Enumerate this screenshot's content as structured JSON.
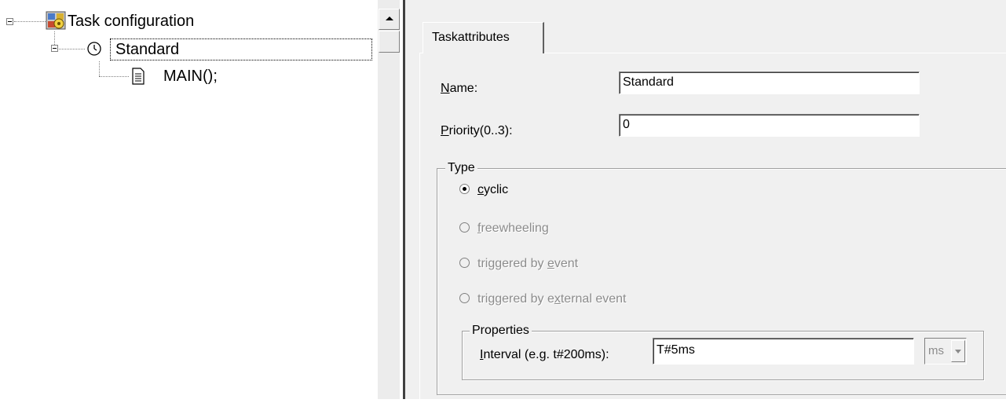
{
  "tree": {
    "root_label": "Task configuration",
    "task_label": "Standard",
    "program_label": "MAIN();"
  },
  "tab": {
    "label": "Taskattributes"
  },
  "fields": {
    "name_label_u": "N",
    "name_label_rest": "ame:",
    "name_value": "Standard",
    "priority_label_u": "P",
    "priority_label_rest": "riority(0..3):",
    "priority_value": "0"
  },
  "type_group": {
    "title": "Type",
    "options": [
      {
        "pre": "",
        "u": "c",
        "post": "yclic",
        "checked": true,
        "enabled": true
      },
      {
        "pre": "",
        "u": "f",
        "post": "reewheeling",
        "checked": false,
        "enabled": false
      },
      {
        "pre": "triggered by ",
        "u": "e",
        "post": "vent",
        "checked": false,
        "enabled": false
      },
      {
        "pre": "triggered by e",
        "u": "x",
        "post": "ternal event",
        "checked": false,
        "enabled": false
      }
    ]
  },
  "properties_group": {
    "title": "Properties",
    "interval_label_u": "I",
    "interval_label_rest": "nterval (e.g. t#200ms):",
    "interval_value": "T#5ms",
    "unit_value": "ms"
  }
}
